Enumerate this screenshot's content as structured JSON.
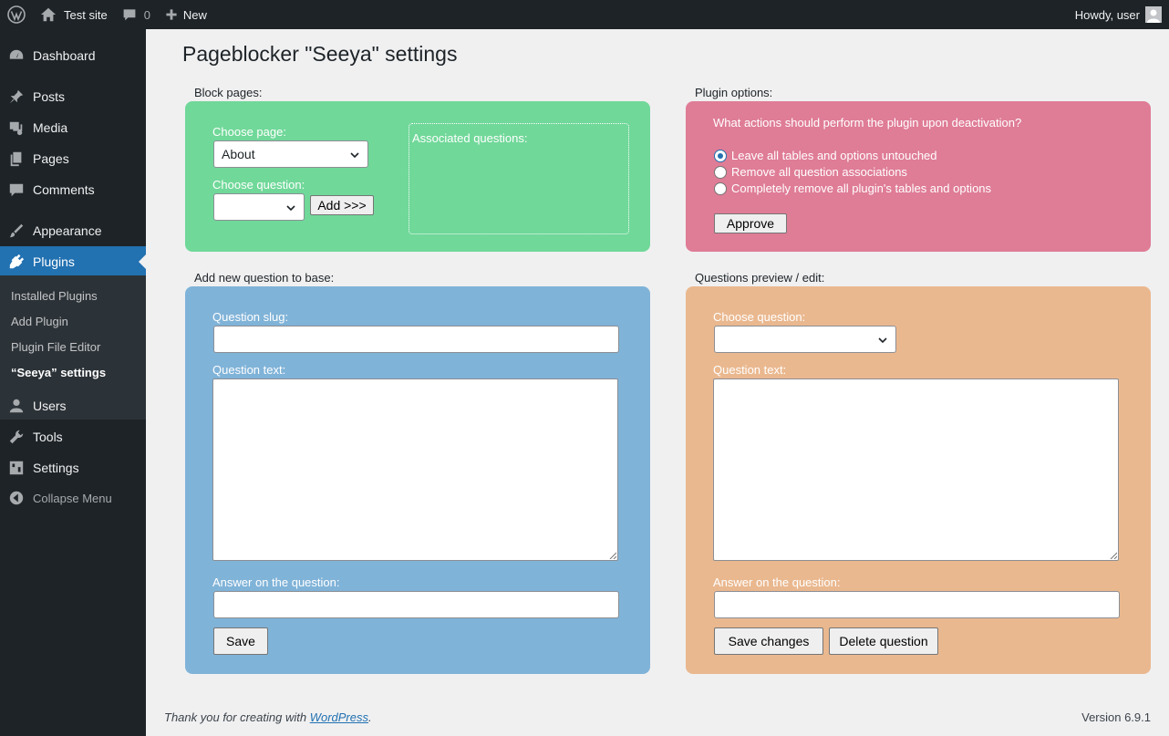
{
  "adminbar": {
    "site_name": "Test site",
    "comments_count": "0",
    "new_label": "New",
    "greeting": "Howdy, user"
  },
  "sidebar": {
    "items": [
      {
        "label": "Dashboard",
        "icon": "dashboard-icon"
      },
      {
        "label": "Posts",
        "icon": "pin-icon"
      },
      {
        "label": "Media",
        "icon": "media-icon"
      },
      {
        "label": "Pages",
        "icon": "pages-icon"
      },
      {
        "label": "Comments",
        "icon": "comment-icon"
      },
      {
        "label": "Appearance",
        "icon": "paintbrush-icon"
      },
      {
        "label": "Plugins",
        "icon": "plug-icon"
      },
      {
        "label": "Users",
        "icon": "user-icon"
      },
      {
        "label": "Tools",
        "icon": "wrench-icon"
      },
      {
        "label": "Settings",
        "icon": "sliders-icon"
      }
    ],
    "submenu": [
      "Installed Plugins",
      "Add Plugin",
      "Plugin File Editor",
      "“Seeya” settings"
    ],
    "collapse_label": "Collapse Menu"
  },
  "page": {
    "title": "Pageblocker \"Seeya\" settings"
  },
  "block_pages": {
    "section_label": "Block pages:",
    "choose_page_label": "Choose page:",
    "choose_page_value": "About",
    "choose_question_label": "Choose question:",
    "choose_question_value": "",
    "add_button": "Add >>>",
    "associated_label": "Associated questions:"
  },
  "plugin_options": {
    "section_label": "Plugin options:",
    "question": "What actions should perform the plugin upon deactivation?",
    "options": [
      {
        "label": "Leave all tables and options untouched",
        "checked": true
      },
      {
        "label": "Remove all question associations",
        "checked": false
      },
      {
        "label": "Completely remove all plugin's tables and options",
        "checked": false
      }
    ],
    "approve_button": "Approve"
  },
  "add_question": {
    "section_label": "Add new question to base:",
    "slug_label": "Question slug:",
    "slug_value": "",
    "text_label": "Question text:",
    "text_value": "",
    "answer_label": "Answer on the question:",
    "answer_value": "",
    "save_button": "Save"
  },
  "preview_edit": {
    "section_label": "Questions preview / edit:",
    "choose_label": "Choose question:",
    "choose_value": "",
    "text_label": "Question text:",
    "text_value": "",
    "answer_label": "Answer on the question:",
    "answer_value": "",
    "save_changes_button": "Save changes",
    "delete_button": "Delete question"
  },
  "footer": {
    "thanks_prefix": "Thank you for creating with ",
    "link_text": "WordPress",
    "thanks_suffix": ".",
    "version": "Version 6.9.1"
  },
  "colors": {
    "block_pages_bg": "#70d899",
    "plugin_options_bg": "#df7c96",
    "add_question_bg": "#80b3d8",
    "preview_edit_bg": "#eab88f",
    "accent": "#2271b1"
  }
}
